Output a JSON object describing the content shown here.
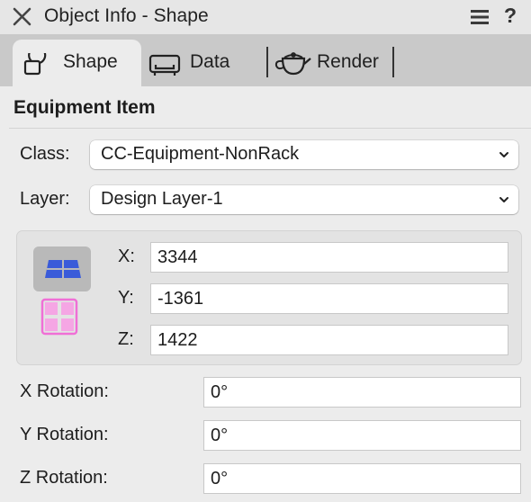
{
  "window": {
    "title": "Object Info - Shape",
    "help_label": "?"
  },
  "tabs": [
    {
      "label": "Shape",
      "icon": "shape-icon",
      "active": true
    },
    {
      "label": "Data",
      "icon": "data-icon",
      "active": false
    },
    {
      "label": "Render",
      "icon": "teapot-icon",
      "active": false
    }
  ],
  "section": {
    "title": "Equipment Item"
  },
  "class_row": {
    "label": "Class:",
    "value": "CC-Equipment-NonRack"
  },
  "layer_row": {
    "label": "Layer:",
    "value": "Design Layer-1"
  },
  "coords": {
    "x_label": "X:",
    "x_value": "3344",
    "y_label": "Y:",
    "y_value": "-1361",
    "z_label": "Z:",
    "z_value": "1422"
  },
  "rotation": {
    "x_label": "X Rotation:",
    "x_value": "0°",
    "y_label": "Y Rotation:",
    "y_value": "0°",
    "z_label": "Z Rotation:",
    "z_value": "0°"
  },
  "colors": {
    "plane_blue": "#3a5bd9",
    "plane_pink": "#f06fd6",
    "tab_strip": "#c9c9c9",
    "panel": "#ececec"
  }
}
